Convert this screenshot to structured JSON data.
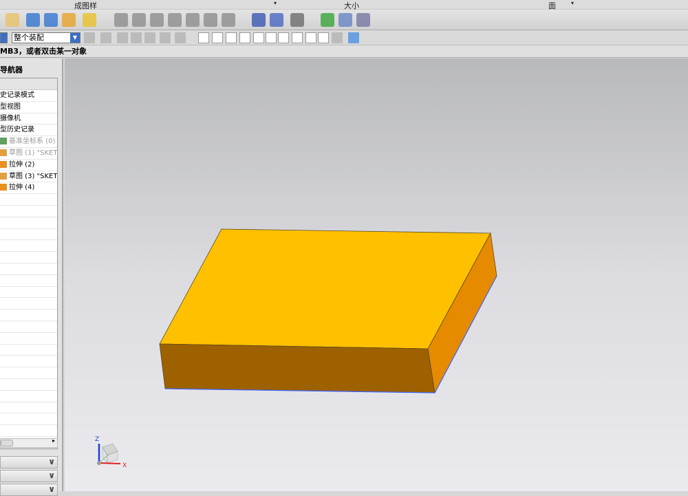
{
  "top_row": {
    "style_label": "成图样",
    "size_label": "大小",
    "face_label": "面"
  },
  "toolbar2": {
    "assembly_select": "整个装配"
  },
  "status": {
    "prompt": "MB3，或者双击某一对象"
  },
  "navigator": {
    "title": "导航器",
    "items": [
      {
        "label": "史记录模式",
        "grey": false
      },
      {
        "label": "型视图",
        "grey": false
      },
      {
        "label": "摄像机",
        "grey": false
      },
      {
        "label": "型历史记录",
        "grey": false
      },
      {
        "label": "基准坐标系 (0)",
        "grey": true,
        "icon": "datum-csys-icon"
      },
      {
        "label": "草图 (1) \"SKET",
        "grey": true,
        "icon": "sketch-icon"
      },
      {
        "label": "拉伸 (2)",
        "grey": false,
        "icon": "extrude-icon"
      },
      {
        "label": "草图 (3) \"SKET",
        "grey": false,
        "icon": "sketch-icon"
      },
      {
        "label": "拉伸 (4)",
        "grey": false,
        "icon": "extrude-icon"
      }
    ]
  },
  "triad": {
    "z": "Z",
    "x": "X"
  },
  "colors": {
    "top_face": "#ffc000",
    "front_face": "#9e6100",
    "side_face": "#e68a00",
    "edge": "#3b63ff"
  },
  "toolbar_icons": [
    "open-icon",
    "check-part-icon",
    "check-geometry-icon",
    "check-body-icon",
    "text-icon",
    "surface-analysis-icon",
    "g0-icon",
    "g1-icon",
    "g2-icon",
    "g3-icon",
    "deviation-icon",
    "cylinder-icon",
    "spring-icon",
    "measure-icon",
    "verify-icon",
    "list-icon",
    "table-icon",
    "csys-icon"
  ]
}
